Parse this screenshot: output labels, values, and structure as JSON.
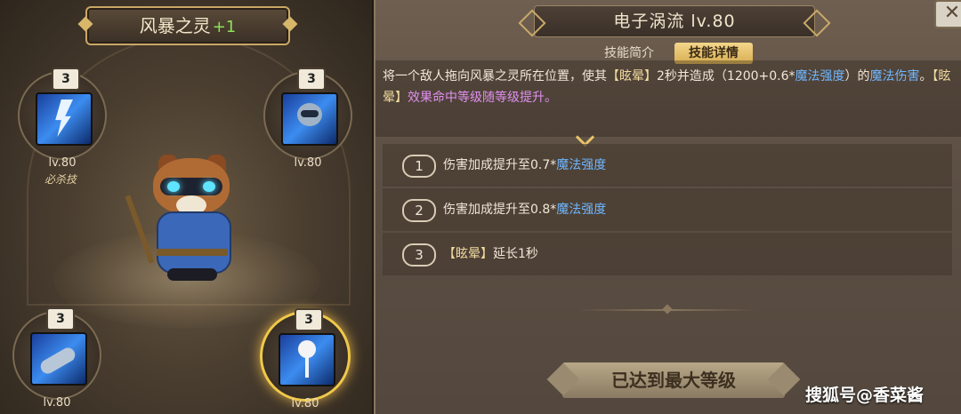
{
  "hero": {
    "name": "风暴之灵",
    "plus": "+1"
  },
  "skills": [
    {
      "count": "3",
      "level": "lv.80",
      "icon": "lightning-icon",
      "note": "必杀技"
    },
    {
      "count": "3",
      "level": "lv.80",
      "icon": "raccoon-hand-icon"
    },
    {
      "count": "3",
      "level": "lv.80",
      "icon": "blue-slash-icon"
    },
    {
      "count": "3",
      "level": "lv.80",
      "icon": "skeleton-shock-icon",
      "selected": true
    }
  ],
  "panel": {
    "title": "电子涡流  lv.80",
    "tabs": [
      "技能简介",
      "技能详情"
    ],
    "active_tab": "技能详情",
    "description": {
      "p1": "将一个敌人拖向风暴之灵所在位置，使其",
      "k1": "【眩晕】",
      "p2": "2秒并造成（1200+0.6*",
      "m1": "魔法强度",
      "p3": "）的",
      "m2": "魔法伤害",
      "p4": "。",
      "k2": "【眩晕】",
      "p5": "效果命中等级随等级提升。"
    },
    "upgrades": [
      {
        "num": "1",
        "text": "伤害加成提升至0.7*",
        "magic": "魔法强度"
      },
      {
        "num": "2",
        "text": "伤害加成提升至0.8*",
        "magic": "魔法强度"
      },
      {
        "num": "3",
        "key": "【眩晕】",
        "text": "延长1秒"
      }
    ],
    "max_level": "已达到最大等级"
  },
  "watermark": "搜狐号@香菜酱",
  "colors": {
    "gold": "#f0c94a",
    "magic": "#6fb6ff",
    "stun_effect": "#e08ff0"
  }
}
